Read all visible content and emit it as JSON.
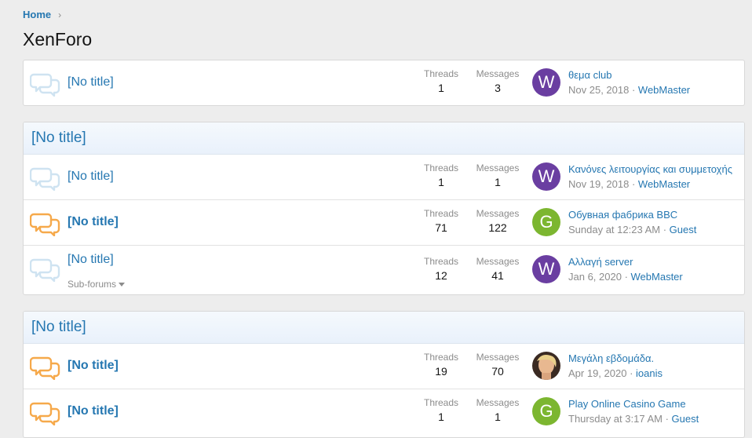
{
  "breadcrumb": {
    "home": "Home"
  },
  "page": {
    "title": "XenForo"
  },
  "labels": {
    "threads": "Threads",
    "messages": "Messages",
    "subforums": "Sub-forums"
  },
  "colors": {
    "link": "#2577b1",
    "read_icon": "#cfe3f1",
    "unread_icon": "#f6a94b",
    "avatar_w": "#6a3ea1",
    "avatar_g": "#7cb630"
  },
  "categories": [
    {
      "title": ""
    },
    {
      "title": "[No title]"
    },
    {
      "title": "[No title]"
    }
  ],
  "nodes": [
    {
      "title": "[No title]",
      "unread": false,
      "threads": "1",
      "messages": "3",
      "avatar_letter": "W",
      "avatar_kind": "letter-w",
      "latest_title": "θεμα club",
      "latest_date": "Nov 25, 2018",
      "latest_user": "WebMaster"
    },
    {
      "title": "[No title]",
      "unread": false,
      "threads": "1",
      "messages": "1",
      "avatar_letter": "W",
      "avatar_kind": "letter-w",
      "latest_title": "Κανόνες λειτουργίας και συμμετοχής",
      "latest_date": "Nov 19, 2018",
      "latest_user": "WebMaster"
    },
    {
      "title": "[No title]",
      "unread": true,
      "threads": "71",
      "messages": "122",
      "avatar_letter": "G",
      "avatar_kind": "letter-g",
      "latest_title": "Обувная фабрика BBC",
      "latest_date": "Sunday at 12:23 AM",
      "latest_user": "Guest"
    },
    {
      "title": "[No title]",
      "unread": false,
      "threads": "12",
      "messages": "41",
      "avatar_letter": "W",
      "avatar_kind": "letter-w",
      "latest_title": "Αλλαγή server",
      "latest_date": "Jan 6, 2020",
      "latest_user": "WebMaster",
      "has_subforums": true
    },
    {
      "title": "[No title]",
      "unread": true,
      "threads": "19",
      "messages": "70",
      "avatar_letter": "",
      "avatar_kind": "photo",
      "latest_title": "Μεγάλη εβδομάδα.",
      "latest_date": "Apr 19, 2020",
      "latest_user": "ioanis"
    },
    {
      "title": "[No title]",
      "unread": true,
      "threads": "1",
      "messages": "1",
      "avatar_letter": "G",
      "avatar_kind": "letter-g",
      "latest_title": "Play Online Casino Game",
      "latest_date": "Thursday at 3:17 AM",
      "latest_user": "Guest"
    }
  ]
}
